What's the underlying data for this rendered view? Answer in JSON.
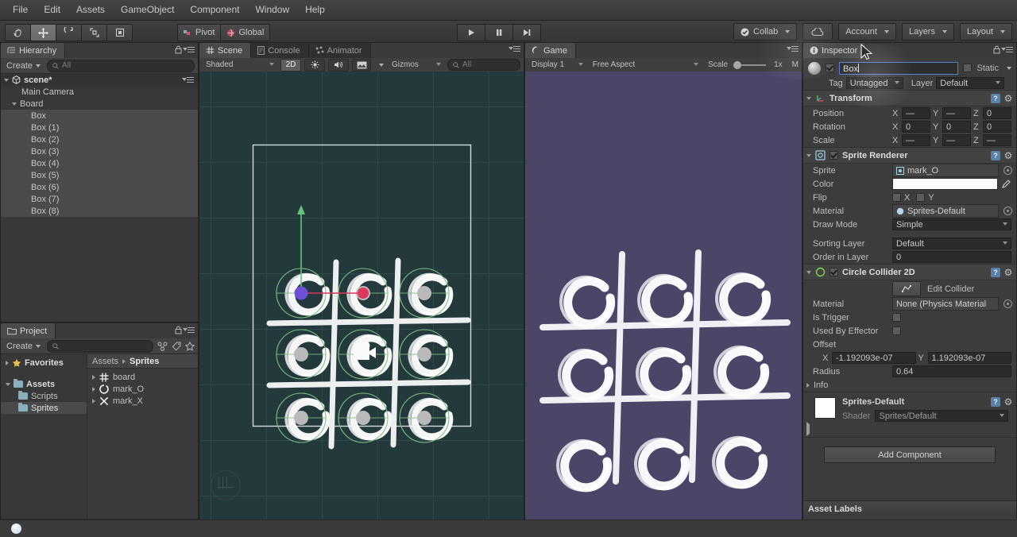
{
  "app": {
    "title": "Unity Editor"
  },
  "menubar": {
    "items": [
      "File",
      "Edit",
      "Assets",
      "GameObject",
      "Component",
      "Window",
      "Help"
    ]
  },
  "toolbar": {
    "tools": [
      {
        "name": "hand-tool",
        "glyph": "✋",
        "active": false
      },
      {
        "name": "move-tool",
        "glyph": "✥",
        "active": true
      },
      {
        "name": "rotate-tool",
        "glyph": "↻",
        "active": false
      },
      {
        "name": "scale-tool",
        "glyph": "⤡",
        "active": false
      },
      {
        "name": "rect-tool",
        "glyph": "▣",
        "active": false
      }
    ],
    "pivot_label": "Pivot",
    "global_label": "Global",
    "play_label": "▶",
    "pause_label": "❚❚",
    "step_label": "▶❘",
    "collab_label": "Collab",
    "cloud_label": "☁",
    "account_label": "Account",
    "layers_label": "Layers",
    "layout_label": "Layout"
  },
  "hierarchy": {
    "tab_label": "Hierarchy",
    "create_label": "Create",
    "search_placeholder": "All",
    "scene_name": "scene*",
    "items": [
      {
        "label": "Main Camera",
        "depth": 2,
        "selected": false,
        "expandable": false
      },
      {
        "label": "Board",
        "depth": 1,
        "selected": false,
        "expandable": true
      },
      {
        "label": "Box",
        "depth": 2,
        "selected": true,
        "expandable": false
      },
      {
        "label": "Box (1)",
        "depth": 2,
        "selected": true,
        "expandable": false
      },
      {
        "label": "Box (2)",
        "depth": 2,
        "selected": true,
        "expandable": false
      },
      {
        "label": "Box (3)",
        "depth": 2,
        "selected": true,
        "expandable": false
      },
      {
        "label": "Box (4)",
        "depth": 2,
        "selected": true,
        "expandable": false
      },
      {
        "label": "Box (5)",
        "depth": 2,
        "selected": true,
        "expandable": false
      },
      {
        "label": "Box (6)",
        "depth": 2,
        "selected": true,
        "expandable": false
      },
      {
        "label": "Box (7)",
        "depth": 2,
        "selected": true,
        "expandable": false
      },
      {
        "label": "Box (8)",
        "depth": 2,
        "selected": true,
        "expandable": false
      }
    ]
  },
  "project": {
    "tab_label": "Project",
    "create_label": "Create",
    "search_placeholder": "",
    "favorites_label": "Favorites",
    "tree": [
      {
        "label": "Assets",
        "depth": 0,
        "selected": false
      },
      {
        "label": "Scripts",
        "depth": 1,
        "selected": false
      },
      {
        "label": "Sprites",
        "depth": 1,
        "selected": true
      }
    ],
    "breadcrumb": [
      "Assets",
      "Sprites"
    ],
    "assets": [
      {
        "label": "board",
        "icon": "board-sprite-icon"
      },
      {
        "label": "mark_O",
        "icon": "circle-sprite-icon"
      },
      {
        "label": "mark_X",
        "icon": "cross-sprite-icon"
      }
    ]
  },
  "scene_view": {
    "tabs": [
      {
        "label": "Scene",
        "icon": "grid-icon",
        "active": true
      },
      {
        "label": "Console",
        "icon": "console-icon",
        "active": false
      },
      {
        "label": "Animator",
        "icon": "animator-icon",
        "active": false
      }
    ],
    "shading_label": "Shaded",
    "mode_2d_label": "2D",
    "lighting_icon": "sun-icon",
    "audio_icon": "speaker-icon",
    "effects_icon": "image-icon",
    "gizmos_label": "Gizmos",
    "search_placeholder": "All"
  },
  "game_view": {
    "tab_label": "Game",
    "display_label": "Display 1",
    "aspect_label": "Free Aspect",
    "scale_label": "Scale",
    "scale_value": "1x",
    "maximize_label": "M"
  },
  "inspector": {
    "tab_label": "Inspector",
    "object_name": "Box",
    "static_label": "Static",
    "tag_label": "Tag",
    "tag_value": "Untagged",
    "layer_label": "Layer",
    "layer_value": "Default",
    "transform": {
      "title": "Transform",
      "rows": [
        {
          "label": "Position",
          "x": "—",
          "y": "—",
          "z": "0"
        },
        {
          "label": "Rotation",
          "x": "0",
          "y": "0",
          "z": "0"
        },
        {
          "label": "Scale",
          "x": "—",
          "y": "—",
          "z": "—"
        }
      ]
    },
    "sprite_renderer": {
      "title": "Sprite Renderer",
      "enabled": true,
      "sprite_label": "Sprite",
      "sprite_value": "mark_O",
      "color_label": "Color",
      "color_value": "#FFFFFF",
      "flip_label": "Flip",
      "flip_x_label": "X",
      "flip_y_label": "Y",
      "material_label": "Material",
      "material_value": "Sprites-Default",
      "draw_mode_label": "Draw Mode",
      "draw_mode_value": "Simple",
      "sorting_layer_label": "Sorting Layer",
      "sorting_layer_value": "Default",
      "order_label": "Order in Layer",
      "order_value": "0"
    },
    "circle_collider": {
      "title": "Circle Collider 2D",
      "enabled": true,
      "edit_collider_label": "Edit Collider",
      "material_label": "Material",
      "material_value": "None (Physics Material",
      "is_trigger_label": "Is Trigger",
      "used_by_effector_label": "Used By Effector",
      "offset_label": "Offset",
      "offset_x": "-1.192093e-07",
      "offset_y": "1.192093e-07",
      "radius_label": "Radius",
      "radius_value": "0.64",
      "info_label": "Info"
    },
    "material_preview": {
      "name": "Sprites-Default",
      "shader_label": "Shader",
      "shader_value": "Sprites/Default"
    },
    "add_component_label": "Add Component",
    "asset_labels_label": "Asset Labels"
  },
  "colors": {
    "scene_bg": "#23393c",
    "game_bg": "#4b4668",
    "gizmo_green": "#7fc07f",
    "gizmo_red": "#e0385c",
    "gizmo_blue": "#6e4fd8",
    "accent_blue": "#5b7bd5"
  },
  "chart_data": {
    "type": "table",
    "title": "Tic-Tac-Toe board (3x3 of mark_O sprites)",
    "categories": [
      "r0c0",
      "r0c1",
      "r0c2",
      "r1c0",
      "r1c1",
      "r1c2",
      "r2c0",
      "r2c1",
      "r2c2"
    ],
    "values": [
      "O",
      "O",
      "O",
      "O",
      "O",
      "O",
      "O",
      "O",
      "O"
    ]
  }
}
